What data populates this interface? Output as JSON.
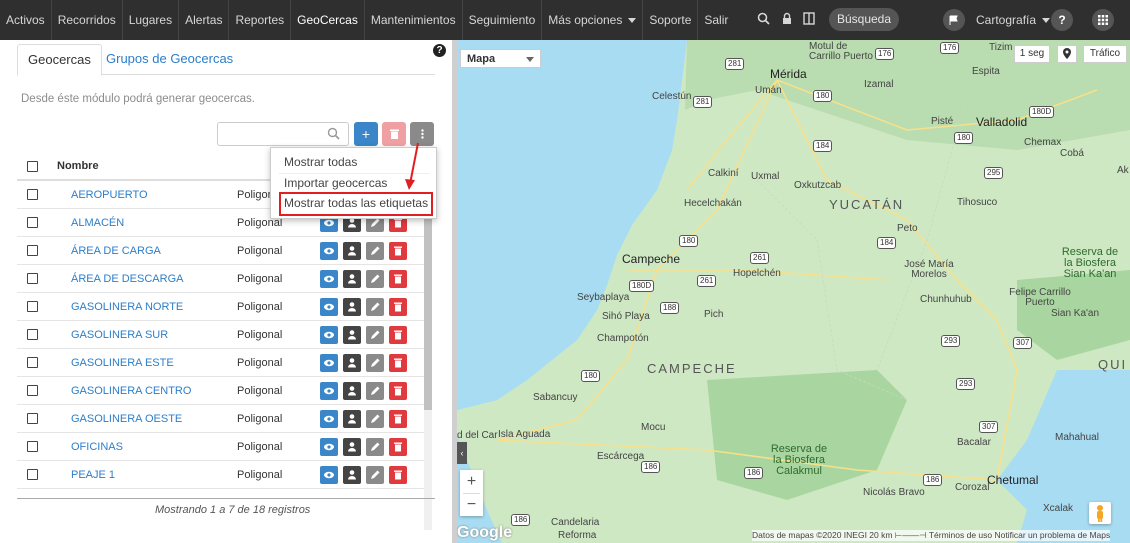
{
  "nav": {
    "items": [
      "Activos",
      "Recorridos",
      "Lugares",
      "Alertas",
      "Reportes",
      "GeoCercas",
      "Mantenimientos",
      "Seguimiento",
      "Más opciones",
      "Soporte",
      "Salir"
    ],
    "search_label": "Búsqueda",
    "cartography_label": "Cartografía"
  },
  "left": {
    "tabs": [
      "Geocercas",
      "Grupos de Geocercas"
    ],
    "description": "Desde éste módulo podrá generar geocercas.",
    "table": {
      "header_name": "Nombre",
      "rows": [
        {
          "name": "AEROPUERTO",
          "type": "Poligonal"
        },
        {
          "name": "ALMACÉN",
          "type": "Poligonal"
        },
        {
          "name": "ÁREA DE CARGA",
          "type": "Poligonal"
        },
        {
          "name": "ÁREA DE DESCARGA",
          "type": "Poligonal"
        },
        {
          "name": "GASOLINERA NORTE",
          "type": "Poligonal"
        },
        {
          "name": "GASOLINERA SUR",
          "type": "Poligonal"
        },
        {
          "name": "GASOLINERA ESTE",
          "type": "Poligonal"
        },
        {
          "name": "GASOLINERA CENTRO",
          "type": "Poligonal"
        },
        {
          "name": "GASOLINERA OESTE",
          "type": "Poligonal"
        },
        {
          "name": "OFICINAS",
          "type": "Poligonal"
        },
        {
          "name": "PEAJE 1",
          "type": "Poligonal"
        }
      ]
    },
    "showing": "Mostrando 1 a 7 de 18 registros"
  },
  "dropdown": {
    "items": [
      "Mostrar todas",
      "Importar geocercas",
      "Mostrar todas las etiquetas"
    ]
  },
  "map": {
    "type_label": "Mapa",
    "refresh_label": "1 seg",
    "traffic_label": "Tráfico",
    "attribution": "Datos de mapas ©2020 INEGI   20 km ⊢——⊣   Términos de uso   Notificar un problema de Maps",
    "google": "Google",
    "labels": {
      "merida": "Mérida",
      "yucatan": "YUCATÁN",
      "campeche_city": "Campeche",
      "campeche_state": "CAMPECHE",
      "valladolid": "Valladolid",
      "chetumal": "Chetumal",
      "tizimin": "Tizim",
      "motul": "Motul de Carrillo Puerto",
      "espita": "Espita",
      "uman": "Umán",
      "izamal": "Izamal",
      "celestun": "Celestún",
      "piste": "Pisté",
      "chemax": "Chemax",
      "coba": "Cobá",
      "calkini": "Calkiní",
      "uxmal": "Uxmal",
      "oxkutzcab": "Oxkutzcab",
      "hecelchakan": "Hecelchakán",
      "peto": "Peto",
      "tihosuco": "Tihosuco",
      "hopelchen": "Hopelchén",
      "jose_maria": "José María Morelos",
      "chunhuhub": "Chunhuhub",
      "felipe": "Felipe Carrillo Puerto",
      "seybaplaya": "Seybaplaya",
      "siho": "Sihó Playa",
      "pich": "Pich",
      "champoton": "Champotón",
      "sabancuy": "Sabancuy",
      "isla": "Isla Aguada",
      "mocu": "Mocu",
      "escarcega": "Escárcega",
      "calakmul": "Reserva de la Biosfera Calakmul",
      "sian": "Reserva de la Biosfera Sian Ka'an",
      "sian2": "Sian Ka'an",
      "bacalar": "Bacalar",
      "mahahual": "Mahahual",
      "nicolas": "Nicolás Bravo",
      "corozal": "Corozal",
      "xcalak": "Xcalak",
      "candelaria": "Candelaria",
      "reforma": "Reforma",
      "ak": "Ak",
      "qui": "QUI",
      "del_car": "d del Car"
    }
  },
  "colors": {
    "nav_bg": "#2f2f2f",
    "link": "#2c7ec9",
    "btn_blue": "#3a86c8",
    "btn_red": "#e0393e",
    "highlight": "#e02020"
  }
}
